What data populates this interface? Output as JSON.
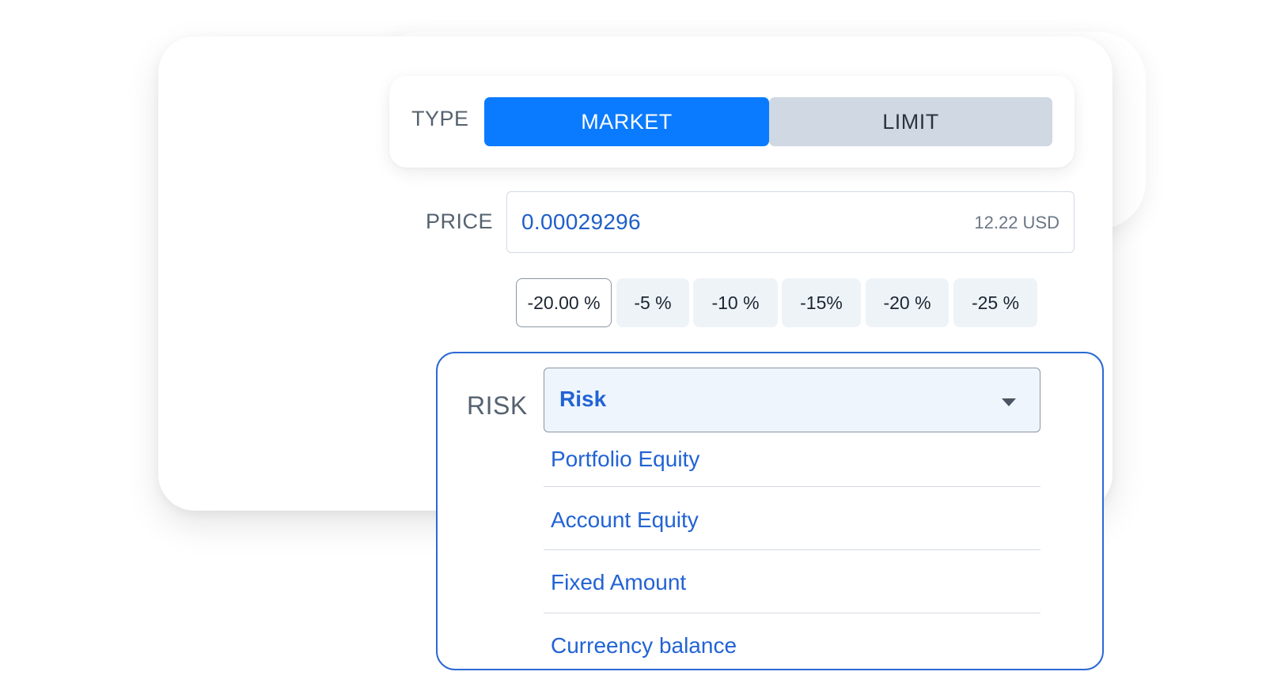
{
  "type": {
    "label": "TYPE",
    "options": [
      "MARKET",
      "LIMIT"
    ],
    "selected": "MARKET"
  },
  "price": {
    "label": "PRICE",
    "value": "0.00029296",
    "usd": "12.22 USD"
  },
  "percent_chips": [
    "-20.00 %",
    "-5 %",
    "-10 %",
    "-15%",
    "-20 %",
    "-25 %"
  ],
  "risk": {
    "label": "RISK",
    "selected": "Risk",
    "options": [
      "Portfolio Equity",
      "Account Equity",
      "Fixed Amount",
      "Curreency balance"
    ]
  },
  "colors": {
    "accent": "#0a7bff",
    "link": "#2263d4",
    "segment_inactive": "#cfd8e3",
    "border_active": "#2c69d4"
  }
}
